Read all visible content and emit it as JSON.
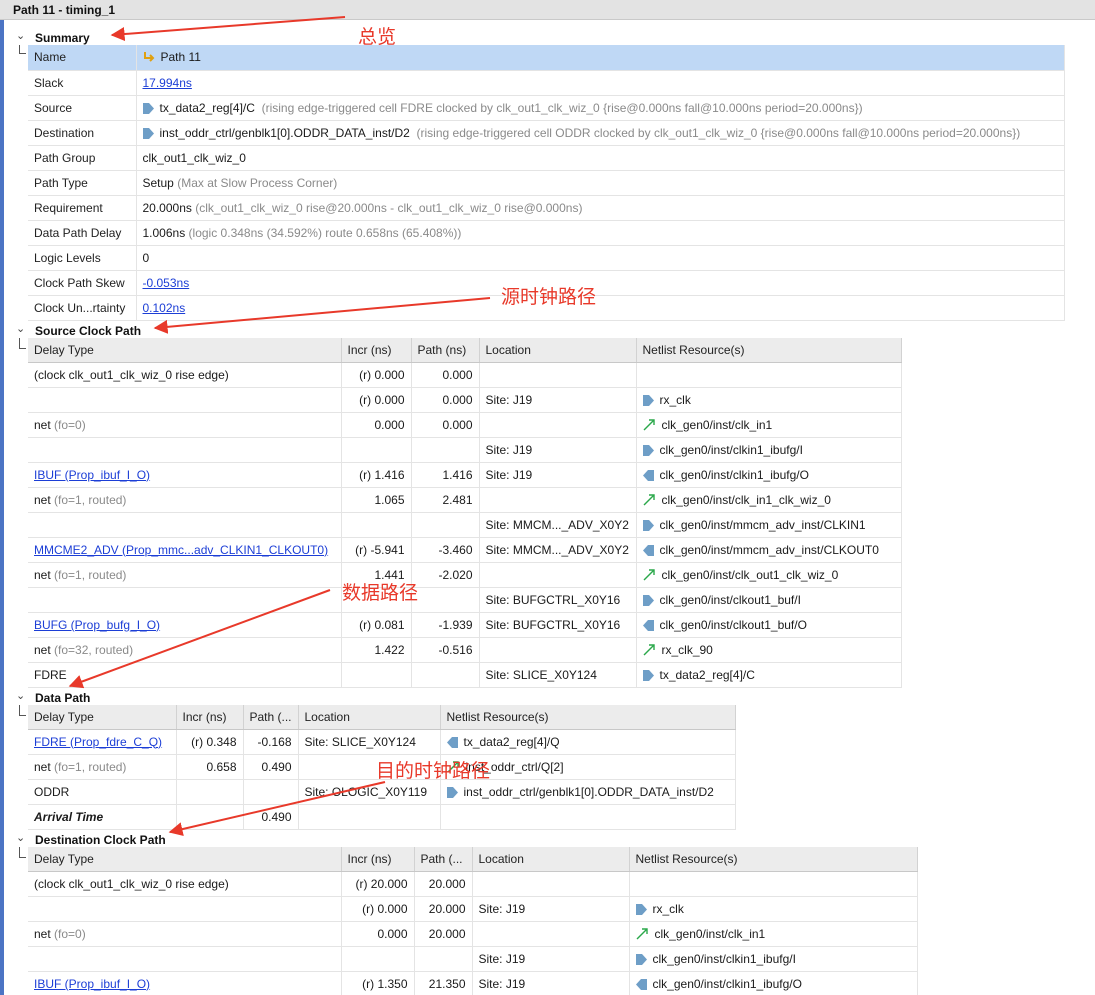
{
  "window": {
    "title": "Path 11 - timing_1"
  },
  "colors": {
    "accent": "#4c74c4",
    "selection": "#bfd8f5",
    "link": "#1c3ed6",
    "annotation": "#e8392a",
    "gray_text": "#8a8a8a"
  },
  "annotations": {
    "summary": "总览",
    "source_clock": "源时钟路径",
    "data_path": "数据路径",
    "dest_clock": "目的时钟路径"
  },
  "sections": {
    "summary": "Summary",
    "source": "Source Clock Path",
    "data": "Data Path",
    "dest": "Destination Clock Path"
  },
  "summary": {
    "name_key": "Name",
    "name_val": "Path 11",
    "slack_key": "Slack",
    "slack_val": "17.994ns",
    "source_key": "Source",
    "source_val": "tx_data2_reg[4]/C",
    "source_note": "(rising edge-triggered cell FDRE clocked by clk_out1_clk_wiz_0  {rise@0.000ns fall@10.000ns period=20.000ns})",
    "dest_key": "Destination",
    "dest_val": "inst_oddr_ctrl/genblk1[0].ODDR_DATA_inst/D2",
    "dest_note": "(rising edge-triggered cell ODDR clocked by clk_out1_clk_wiz_0  {rise@0.000ns fall@10.000ns period=20.000ns})",
    "group_key": "Path Group",
    "group_val": "clk_out1_clk_wiz_0",
    "type_key": "Path Type",
    "type_val": "Setup",
    "type_note": "(Max at Slow Process Corner)",
    "req_key": "Requirement",
    "req_val": "20.000ns",
    "req_note": "(clk_out1_clk_wiz_0 rise@20.000ns - clk_out1_clk_wiz_0 rise@0.000ns)",
    "dpd_key": "Data Path Delay",
    "dpd_val": "1.006ns",
    "dpd_note": "(logic 0.348ns (34.592%)  route 0.658ns (65.408%))",
    "ll_key": "Logic Levels",
    "ll_val": "0",
    "skew_key": "Clock Path Skew",
    "skew_val": "-0.053ns",
    "unc_key": "Clock Un...rtainty",
    "unc_val": "0.102ns"
  },
  "source_clock": {
    "headers": [
      "Delay Type",
      "Incr (ns)",
      "Path (ns)",
      "Location",
      "Netlist Resource(s)"
    ],
    "rows": [
      {
        "type": "(clock clk_out1_clk_wiz_0 rise edge)",
        "type_note": "",
        "link": false,
        "incr": "(r) 0.000",
        "path": "0.000",
        "loc": "",
        "res": "",
        "icon": ""
      },
      {
        "type": "",
        "type_note": "",
        "link": false,
        "incr": "(r) 0.000",
        "path": "0.000",
        "loc": "Site: J19",
        "res": "rx_clk",
        "icon": "pin-in"
      },
      {
        "type": "net",
        "type_note": "(fo=0)",
        "link": false,
        "incr": "0.000",
        "path": "0.000",
        "loc": "",
        "res": "clk_gen0/inst/clk_in1",
        "icon": "net"
      },
      {
        "type": "",
        "type_note": "",
        "link": false,
        "incr": "",
        "path": "",
        "loc": "Site: J19",
        "res": "clk_gen0/inst/clkin1_ibufg/I",
        "icon": "pin-in"
      },
      {
        "type": "IBUF (Prop_ibuf_I_O)",
        "type_note": "",
        "link": true,
        "incr": "(r) 1.416",
        "path": "1.416",
        "loc": "Site: J19",
        "res": "clk_gen0/inst/clkin1_ibufg/O",
        "icon": "pin-out"
      },
      {
        "type": "net",
        "type_note": "(fo=1, routed)",
        "link": false,
        "incr": "1.065",
        "path": "2.481",
        "loc": "",
        "res": "clk_gen0/inst/clk_in1_clk_wiz_0",
        "icon": "net"
      },
      {
        "type": "",
        "type_note": "",
        "link": false,
        "incr": "",
        "path": "",
        "loc": "Site: MMCM..._ADV_X0Y2",
        "res": "clk_gen0/inst/mmcm_adv_inst/CLKIN1",
        "icon": "pin-in"
      },
      {
        "type": "MMCME2_ADV (Prop_mmc...adv_CLKIN1_CLKOUT0)",
        "type_note": "",
        "link": true,
        "incr": "(r) -5.941",
        "path": "-3.460",
        "loc": "Site: MMCM..._ADV_X0Y2",
        "res": "clk_gen0/inst/mmcm_adv_inst/CLKOUT0",
        "icon": "pin-out"
      },
      {
        "type": "net",
        "type_note": "(fo=1, routed)",
        "link": false,
        "incr": "1.441",
        "path": "-2.020",
        "loc": "",
        "res": "clk_gen0/inst/clk_out1_clk_wiz_0",
        "icon": "net"
      },
      {
        "type": "",
        "type_note": "",
        "link": false,
        "incr": "",
        "path": "",
        "loc": "Site: BUFGCTRL_X0Y16",
        "res": "clk_gen0/inst/clkout1_buf/I",
        "icon": "pin-in"
      },
      {
        "type": "BUFG (Prop_bufg_I_O)",
        "type_note": "",
        "link": true,
        "incr": "(r) 0.081",
        "path": "-1.939",
        "loc": "Site: BUFGCTRL_X0Y16",
        "res": "clk_gen0/inst/clkout1_buf/O",
        "icon": "pin-out"
      },
      {
        "type": "net",
        "type_note": "(fo=32, routed)",
        "link": false,
        "incr": "1.422",
        "path": "-0.516",
        "loc": "",
        "res": "rx_clk_90",
        "icon": "net"
      },
      {
        "type": "FDRE",
        "type_note": "",
        "link": false,
        "incr": "",
        "path": "",
        "loc": "Site: SLICE_X0Y124",
        "res": "tx_data2_reg[4]/C",
        "icon": "pin-in"
      }
    ]
  },
  "data_path": {
    "headers": [
      "Delay Type",
      "Incr (ns)",
      "Path (...",
      "Location",
      "Netlist Resource(s)"
    ],
    "rows": [
      {
        "type": "FDRE (Prop_fdre_C_Q)",
        "type_note": "",
        "link": true,
        "bold": false,
        "incr": "(r) 0.348",
        "path": "-0.168",
        "loc": "Site: SLICE_X0Y124",
        "res": "tx_data2_reg[4]/Q",
        "icon": "pin-out"
      },
      {
        "type": "net",
        "type_note": "(fo=1, routed)",
        "link": false,
        "bold": false,
        "incr": "0.658",
        "path": "0.490",
        "loc": "",
        "res": "inst_oddr_ctrl/Q[2]",
        "icon": "net"
      },
      {
        "type": "ODDR",
        "type_note": "",
        "link": false,
        "bold": false,
        "incr": "",
        "path": "",
        "loc": "Site: OLOGIC_X0Y119",
        "res": "inst_oddr_ctrl/genblk1[0].ODDR_DATA_inst/D2",
        "icon": "pin-in"
      },
      {
        "type": "Arrival Time",
        "type_note": "",
        "link": false,
        "bold": true,
        "incr": "",
        "path": "0.490",
        "loc": "",
        "res": "",
        "icon": ""
      }
    ]
  },
  "dest_clock": {
    "headers": [
      "Delay Type",
      "Incr (ns)",
      "Path (...",
      "Location",
      "Netlist Resource(s)"
    ],
    "rows": [
      {
        "type": "(clock clk_out1_clk_wiz_0 rise edge)",
        "type_note": "",
        "link": false,
        "incr": "(r) 20.000",
        "path": "20.000",
        "loc": "",
        "res": "",
        "icon": ""
      },
      {
        "type": "",
        "type_note": "",
        "link": false,
        "incr": "(r) 0.000",
        "path": "20.000",
        "loc": "Site: J19",
        "res": "rx_clk",
        "icon": "pin-in"
      },
      {
        "type": "net",
        "type_note": "(fo=0)",
        "link": false,
        "incr": "0.000",
        "path": "20.000",
        "loc": "",
        "res": "clk_gen0/inst/clk_in1",
        "icon": "net"
      },
      {
        "type": "",
        "type_note": "",
        "link": false,
        "incr": "",
        "path": "",
        "loc": "Site: J19",
        "res": "clk_gen0/inst/clkin1_ibufg/I",
        "icon": "pin-in"
      },
      {
        "type": "IBUF (Prop_ibuf_I_O)",
        "type_note": "",
        "link": true,
        "incr": "(r) 1.350",
        "path": "21.350",
        "loc": "Site: J19",
        "res": "clk_gen0/inst/clkin1_ibufg/O",
        "icon": "pin-out"
      }
    ]
  }
}
